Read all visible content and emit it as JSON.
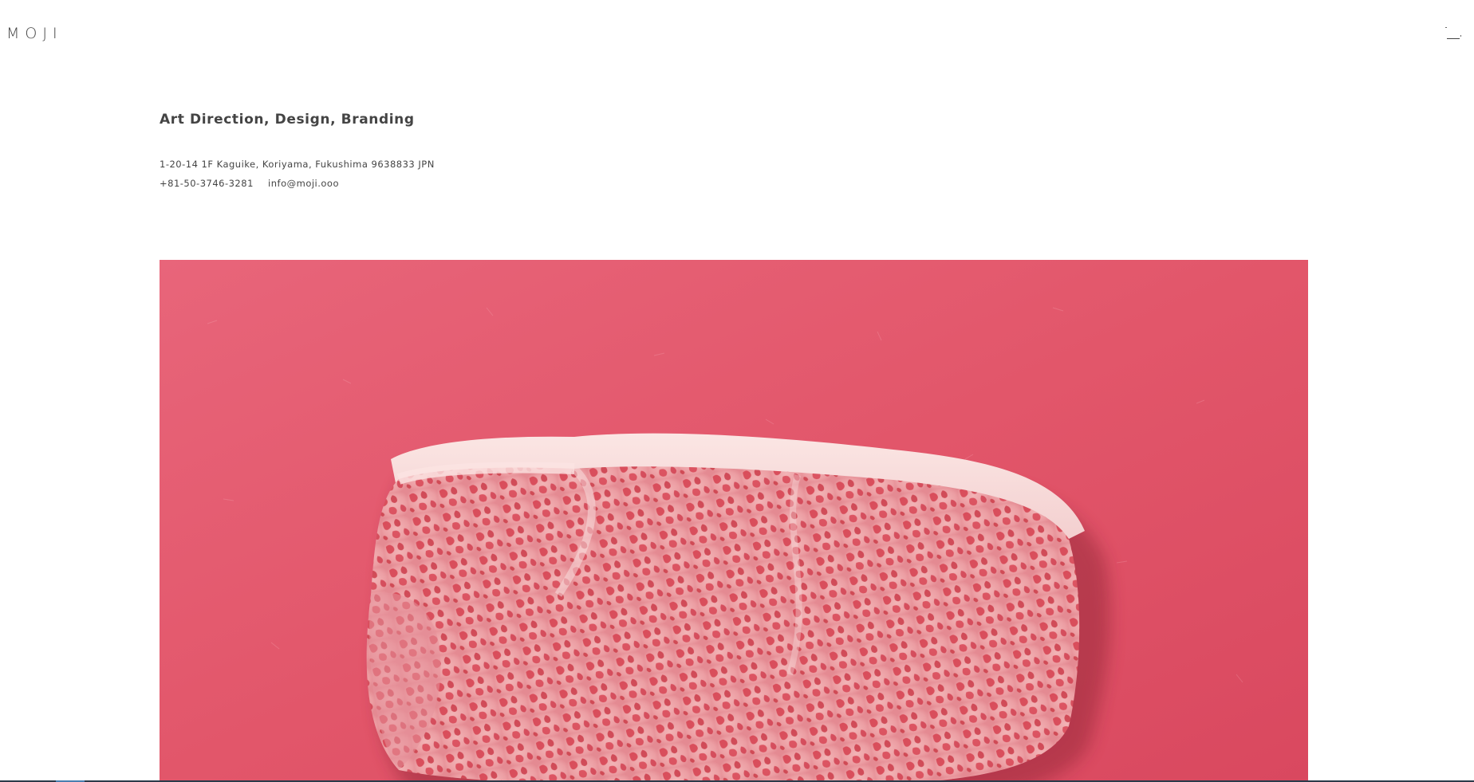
{
  "header": {
    "logo": "MOJI",
    "menu_icon": "menu-icon"
  },
  "intro": {
    "tagline": "Art Direction, Design, Branding",
    "address": "1-20-14 1F Kaguike, Koriyama, Fukushima 9638833 JPN",
    "phone": "+81-50-3746-3281",
    "email": "info@moji.ooo"
  },
  "hero": {
    "image": "marbled-wagyu-steak-photo",
    "background_color": "#e2566a"
  },
  "colors": {
    "text": "#444444",
    "background": "#ffffff",
    "accent_red": "#e2566a"
  }
}
